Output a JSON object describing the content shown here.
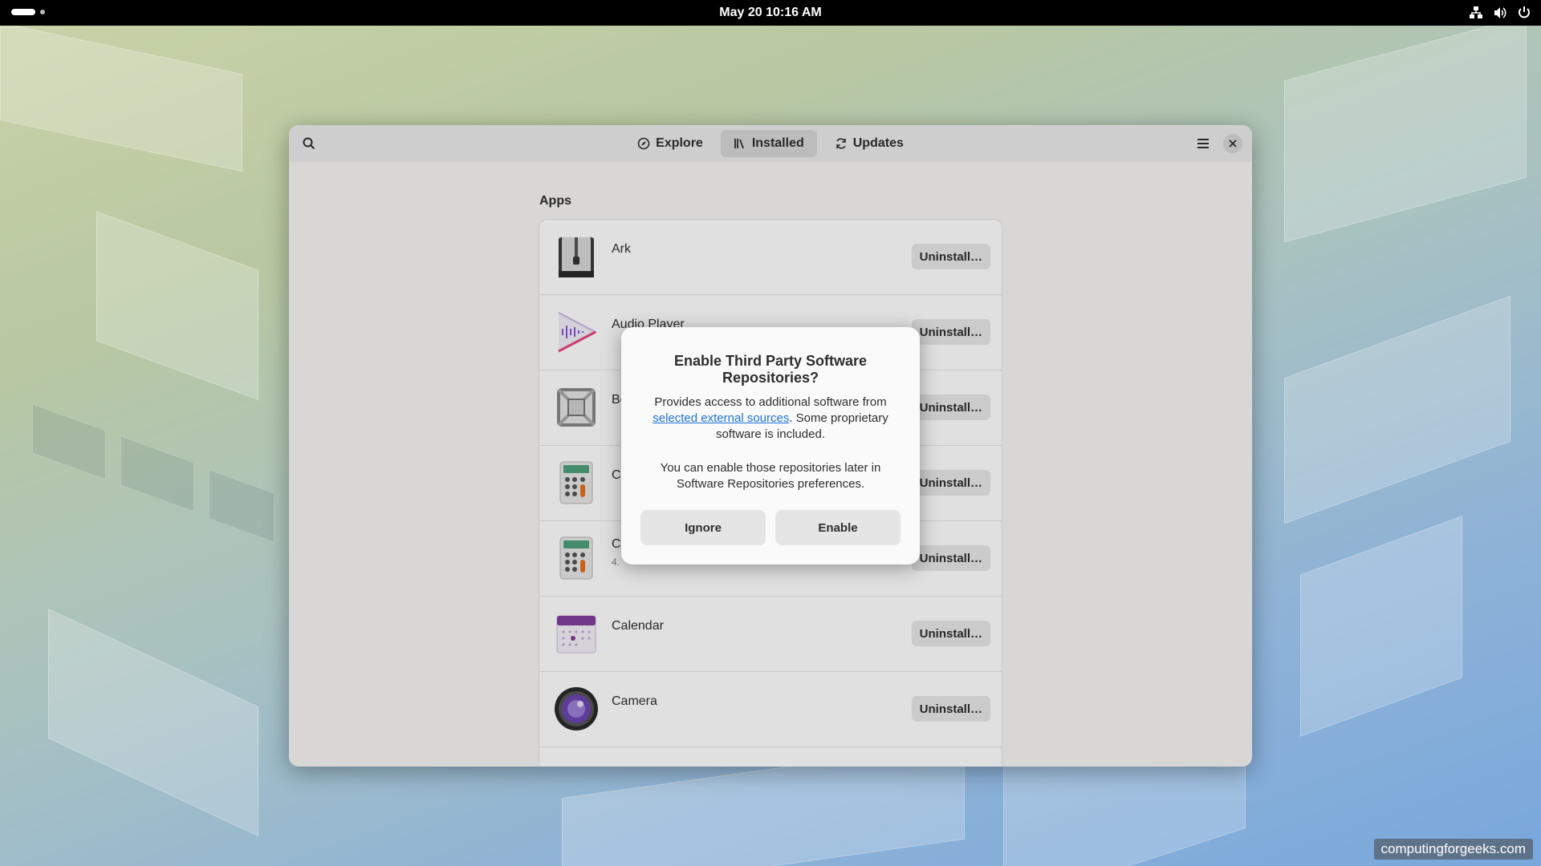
{
  "topbar": {
    "clock": "May 20  10:16 AM",
    "icons": [
      "network-icon",
      "volume-icon",
      "power-icon"
    ]
  },
  "window": {
    "tabs": [
      {
        "label": "Explore",
        "icon": "compass-icon",
        "active": false
      },
      {
        "label": "Installed",
        "icon": "library-icon",
        "active": true
      },
      {
        "label": "Updates",
        "icon": "refresh-icon",
        "active": false
      }
    ],
    "section_title": "Apps",
    "apps": [
      {
        "name": "Ark",
        "sub": "",
        "action": "Uninstall…"
      },
      {
        "name": "Audio Player",
        "sub": "",
        "action": "Uninstall…"
      },
      {
        "name": "Be",
        "sub": "",
        "action": "Uninstall…"
      },
      {
        "name": "C",
        "sub": "",
        "action": "Uninstall…"
      },
      {
        "name": "C",
        "sub": "4.",
        "action": "Uninstall…"
      },
      {
        "name": "Calendar",
        "sub": "",
        "action": "Uninstall…"
      },
      {
        "name": "Camera",
        "sub": "",
        "action": "Uninstall…"
      },
      {
        "name": "",
        "sub": "",
        "action": ""
      }
    ]
  },
  "dialog": {
    "title": "Enable Third Party Software Repositories?",
    "body_before": "Provides access to additional software from ",
    "body_link": "selected external sources",
    "body_after": ". Some proprietary software is included.",
    "body2": "You can enable those repositories later in Software Repositories preferences.",
    "ignore_label": "Ignore",
    "enable_label": "Enable"
  },
  "watermark": "computingforgeeks.com",
  "colors": {
    "accent": "#1c71d8",
    "topbar": "#000000"
  }
}
